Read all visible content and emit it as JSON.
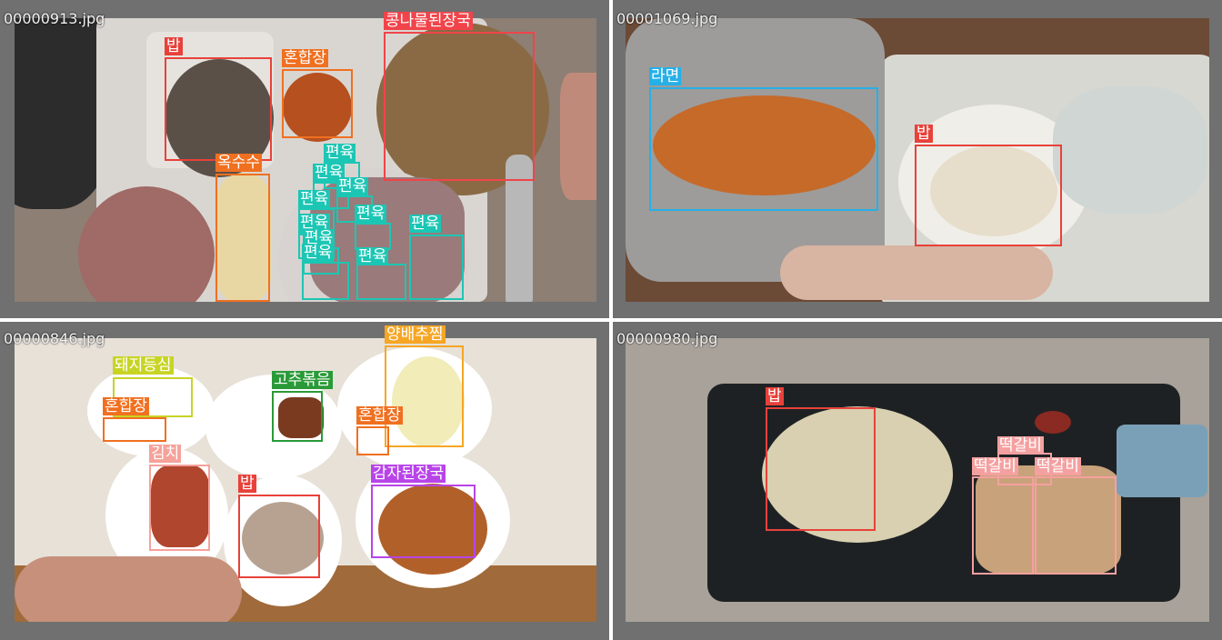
{
  "colors": {
    "bap": "#e8413a",
    "honhapjang": "#f07020",
    "kongnamul": "#f0444a",
    "oksusu": "#f07020",
    "pyeonyuk": "#1cc6b4",
    "ramyeon": "#26b0e8",
    "dwaeji": "#c8d424",
    "gochu": "#2a9a38",
    "yangbaechu": "#f6a624",
    "gimchi": "#f5a29a",
    "gamja": "#b844e8",
    "tteokgalbi": "#f5a0a0",
    "panel_bg": "#707070"
  },
  "panels": [
    {
      "filename": "00000913.jpg",
      "detections": [
        {
          "label": "밥",
          "color_key": "bap"
        },
        {
          "label": "혼합장",
          "color_key": "honhapjang"
        },
        {
          "label": "콩나물된장국",
          "color_key": "kongnamul"
        },
        {
          "label": "옥수수",
          "color_key": "oksusu"
        },
        {
          "label": "편육",
          "color_key": "pyeonyuk"
        },
        {
          "label": "편육",
          "color_key": "pyeonyuk"
        },
        {
          "label": "편육",
          "color_key": "pyeonyuk"
        },
        {
          "label": "편육",
          "color_key": "pyeonyuk"
        },
        {
          "label": "편육",
          "color_key": "pyeonyuk"
        },
        {
          "label": "편육",
          "color_key": "pyeonyuk"
        },
        {
          "label": "편육",
          "color_key": "pyeonyuk"
        },
        {
          "label": "편육",
          "color_key": "pyeonyuk"
        },
        {
          "label": "편육",
          "color_key": "pyeonyuk"
        },
        {
          "label": "편육",
          "color_key": "pyeonyuk"
        }
      ]
    },
    {
      "filename": "00001069.jpg",
      "detections": [
        {
          "label": "라면",
          "color_key": "ramyeon"
        },
        {
          "label": "밥",
          "color_key": "bap"
        }
      ]
    },
    {
      "filename": "00000846.jpg",
      "detections": [
        {
          "label": "돼지등심",
          "color_key": "dwaeji"
        },
        {
          "label": "혼합장",
          "color_key": "honhapjang"
        },
        {
          "label": "고추볶음",
          "color_key": "gochu"
        },
        {
          "label": "양배추찜",
          "color_key": "yangbaechu"
        },
        {
          "label": "혼합장",
          "color_key": "honhapjang"
        },
        {
          "label": "김치",
          "color_key": "gimchi"
        },
        {
          "label": "밥",
          "color_key": "bap"
        },
        {
          "label": "감자된장국",
          "color_key": "gamja"
        }
      ]
    },
    {
      "filename": "00000980.jpg",
      "detections": [
        {
          "label": "밥",
          "color_key": "bap"
        },
        {
          "label": "떡갈비",
          "color_key": "tteokgalbi"
        },
        {
          "label": "떡갈비",
          "color_key": "tteokgalbi"
        },
        {
          "label": "떡갈비",
          "color_key": "tteokgalbi"
        }
      ]
    }
  ]
}
